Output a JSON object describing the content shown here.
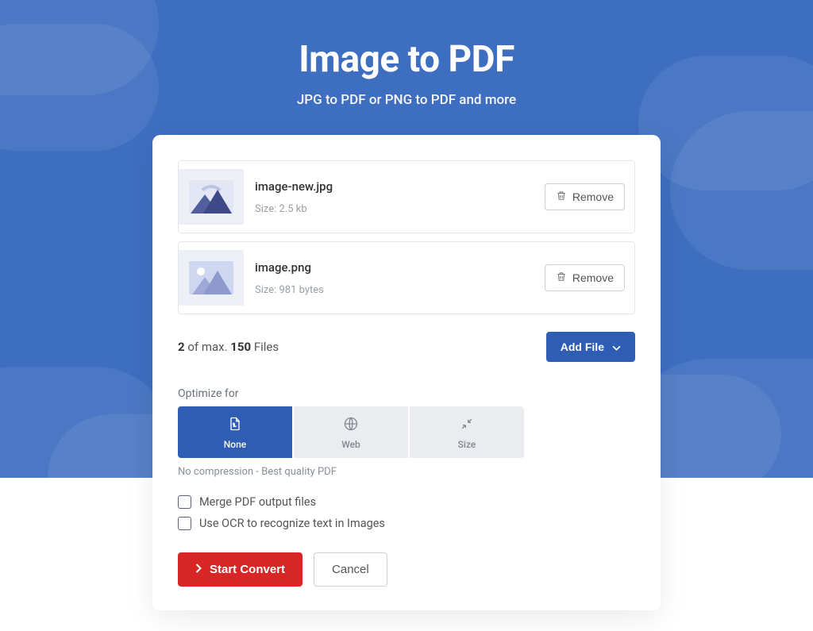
{
  "hero": {
    "title": "Image to PDF",
    "subtitle": "JPG to PDF or PNG to PDF and more"
  },
  "files": [
    {
      "name": "image-new.jpg",
      "size_label": "Size: 2.5 kb",
      "remove_label": "Remove"
    },
    {
      "name": "image.png",
      "size_label": "Size: 981 bytes",
      "remove_label": "Remove"
    }
  ],
  "counter": {
    "count": "2",
    "mid": " of max. ",
    "max": "150",
    "suffix": " Files"
  },
  "add_file_label": "Add File",
  "optimize": {
    "label": "Optimize for",
    "tabs": {
      "none": "None",
      "web": "Web",
      "size": "Size"
    },
    "hint": "No compression - Best quality PDF"
  },
  "options": {
    "merge": "Merge PDF output files",
    "ocr": "Use OCR to recognize text in Images"
  },
  "actions": {
    "start": "Start Convert",
    "cancel": "Cancel"
  },
  "colors": {
    "brand_blue": "#2e5db3",
    "brand_red": "#d82626",
    "hero_bg": "#3e6ec0"
  }
}
